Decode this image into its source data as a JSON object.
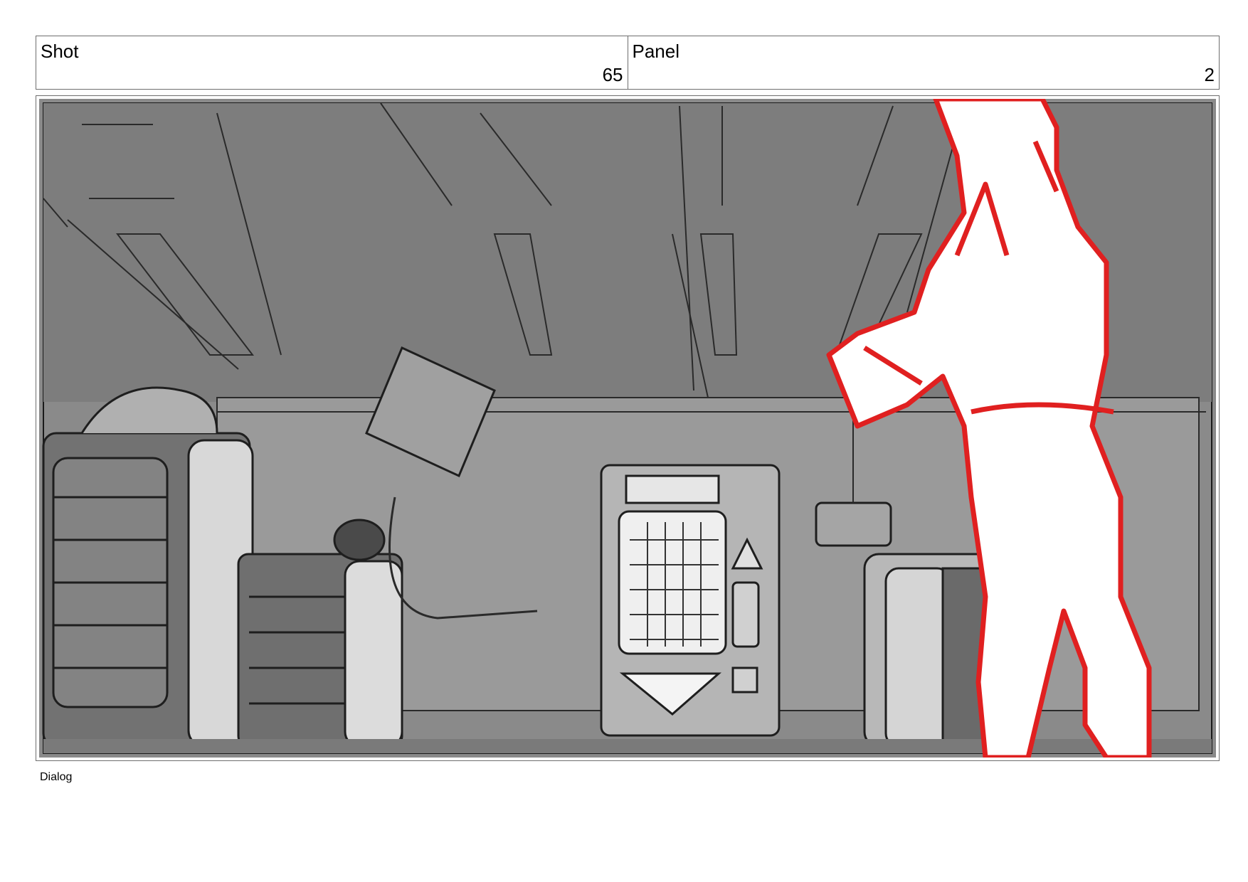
{
  "header": {
    "shot_label": "Shot",
    "shot_number": "65",
    "panel_label": "Panel",
    "panel_number": "2"
  },
  "dialog_label": "Dialog"
}
